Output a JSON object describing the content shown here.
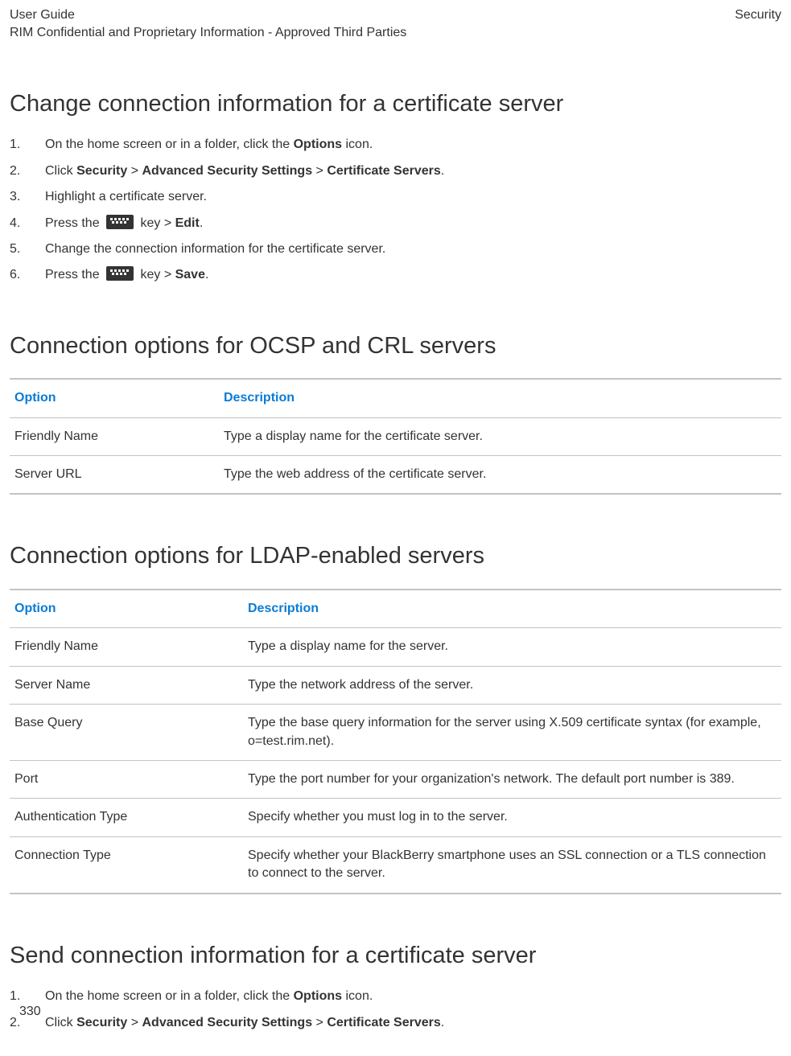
{
  "header": {
    "guide": "User Guide",
    "confidential": "RIM Confidential and Proprietary Information - Approved Third Parties",
    "section": "Security"
  },
  "section1": {
    "heading": "Change connection information for a certificate server",
    "steps": {
      "s1a": "On the home screen or in a folder, click the ",
      "s1b": "Options",
      "s1c": " icon.",
      "s2a": "Click ",
      "s2b": "Security",
      "s2c": " > ",
      "s2d": "Advanced Security Settings",
      "s2e": " > ",
      "s2f": "Certificate Servers",
      "s2g": ".",
      "s3": "Highlight a certificate server.",
      "s4a": "Press the ",
      "s4b": " key > ",
      "s4c": "Edit",
      "s4d": ".",
      "s5": "Change the connection information for the certificate server.",
      "s6a": "Press the ",
      "s6b": " key > ",
      "s6c": "Save",
      "s6d": "."
    }
  },
  "section2": {
    "heading": "Connection options for OCSP and CRL servers",
    "headers": {
      "option": "Option",
      "description": "Description"
    },
    "rows": [
      {
        "option": "Friendly Name",
        "description": "Type a display name for the certificate server."
      },
      {
        "option": "Server URL",
        "description": "Type the web address of the certificate server."
      }
    ]
  },
  "section3": {
    "heading": "Connection options for LDAP-enabled servers",
    "headers": {
      "option": "Option",
      "description": "Description"
    },
    "rows": [
      {
        "option": "Friendly Name",
        "description": "Type a display name for the server."
      },
      {
        "option": "Server Name",
        "description": "Type the network address of the server."
      },
      {
        "option": "Base Query",
        "description": "Type the base query information for the server using X.509 certificate syntax (for example, o=test.rim.net)."
      },
      {
        "option": "Port",
        "description": "Type the port number for your organization's network. The default port number is 389."
      },
      {
        "option": "Authentication Type",
        "description": "Specify whether you must log in to the server."
      },
      {
        "option": "Connection Type",
        "description": "Specify whether your BlackBerry smartphone uses an SSL connection or a TLS connection to connect to the server."
      }
    ]
  },
  "section4": {
    "heading": "Send connection information for a certificate server",
    "steps": {
      "s1a": "On the home screen or in a folder, click the ",
      "s1b": "Options",
      "s1c": " icon.",
      "s2a": "Click ",
      "s2b": "Security",
      "s2c": " > ",
      "s2d": "Advanced Security Settings",
      "s2e": " > ",
      "s2f": "Certificate Servers",
      "s2g": "."
    }
  },
  "pageNumber": "330"
}
